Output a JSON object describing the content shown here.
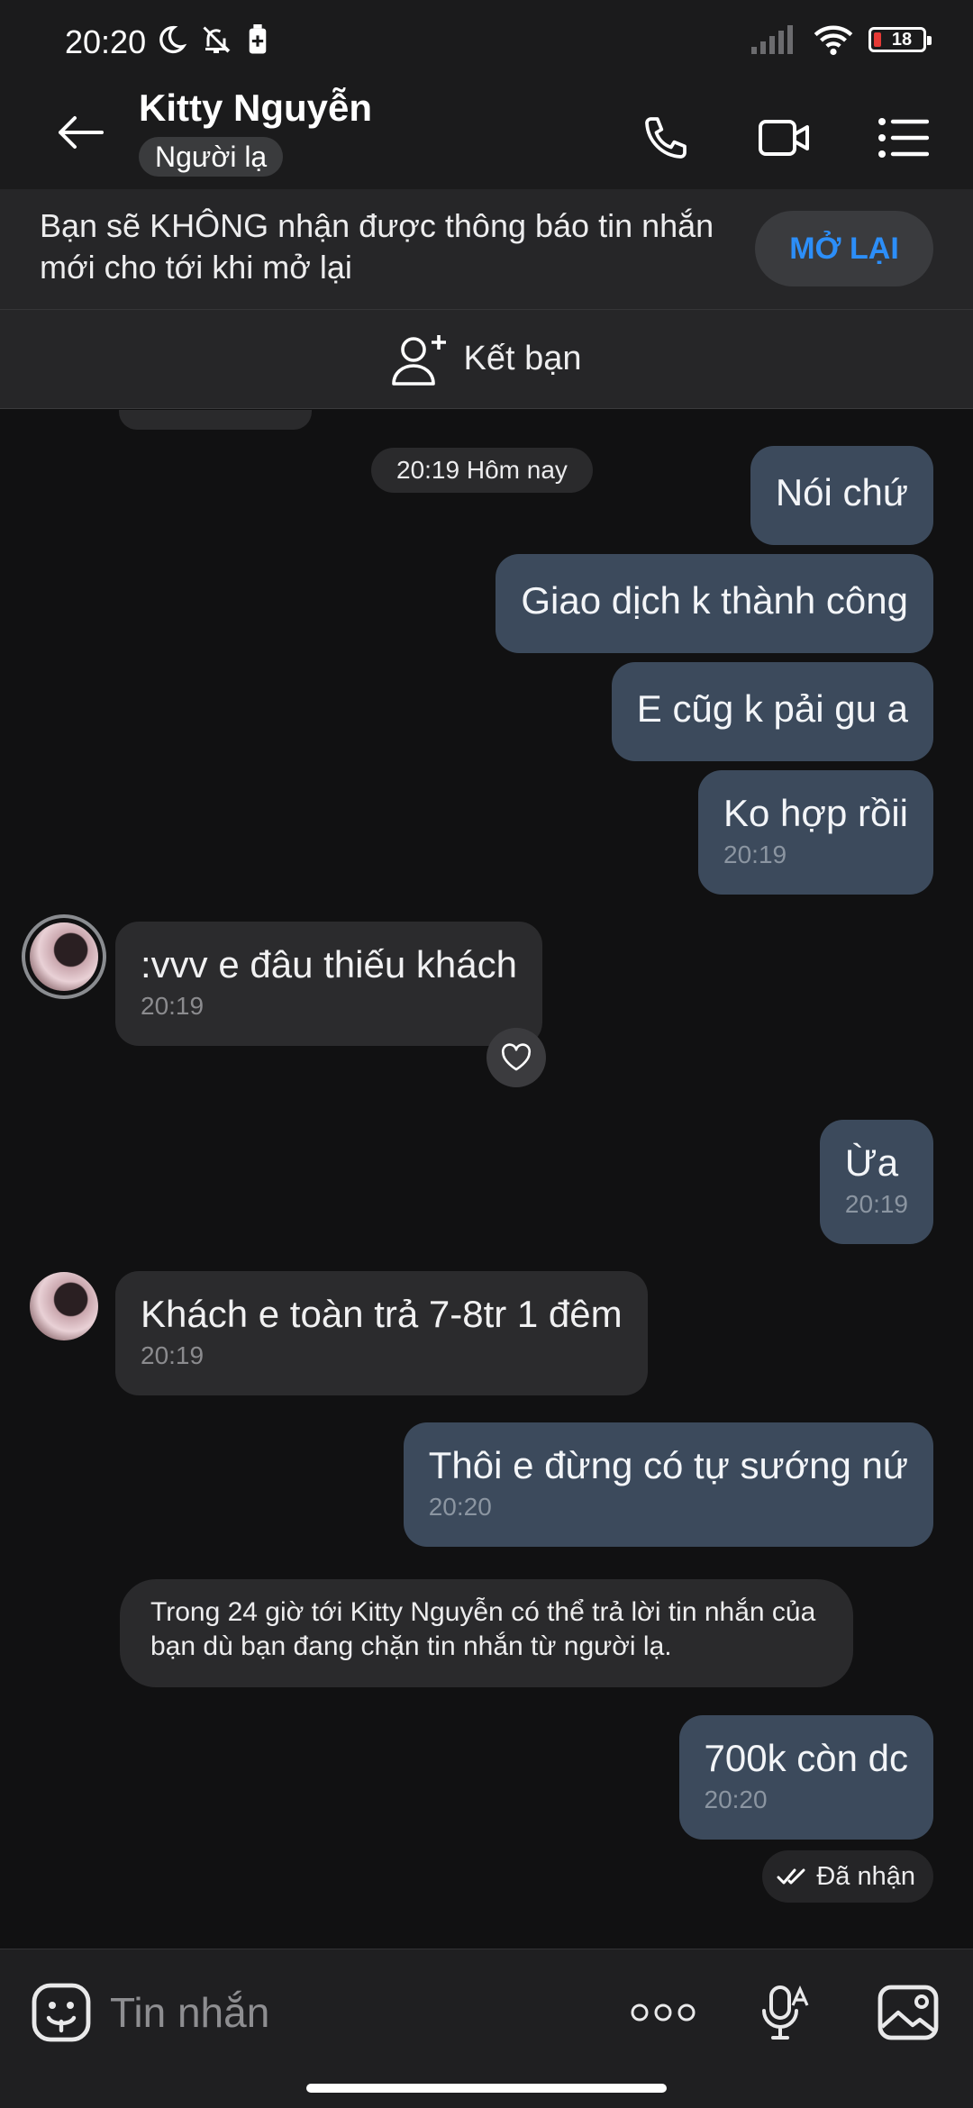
{
  "status_bar": {
    "time": "20:20",
    "battery": "18",
    "icons": [
      "moon-icon",
      "mute-icon",
      "battery-saver-icon",
      "signal-icon",
      "wifi-icon",
      "battery-icon"
    ]
  },
  "header": {
    "name": "Kitty Nguyễn",
    "badge": "Người lạ"
  },
  "notice": {
    "text": "Bạn sẽ KHÔNG nhận được thông báo tin nhắn mới cho tới khi mở lại",
    "button": "MỞ LẠI"
  },
  "add_friend": {
    "label": "Kết bạn"
  },
  "chat": {
    "date_chip": "20:19 Hôm nay",
    "messages": [
      {
        "dir": "out",
        "text": "Nói chứ",
        "time": ""
      },
      {
        "dir": "out",
        "text": "Giao dịch k thành công",
        "time": ""
      },
      {
        "dir": "out",
        "text": "E cũg k pải gu a",
        "time": ""
      },
      {
        "dir": "out",
        "text": "Ko hợp rồii",
        "time": "20:19"
      },
      {
        "dir": "in",
        "text": ":vvv e đâu thiếu khách",
        "time": "20:19"
      },
      {
        "dir": "out",
        "text": "Ừa",
        "time": "20:19"
      },
      {
        "dir": "in",
        "text": "Khách e toàn trả 7-8tr 1 đêm",
        "time": "20:19"
      },
      {
        "dir": "out",
        "text": "Thôi e đừng có tự sướng nứ",
        "time": "20:20"
      },
      {
        "dir": "out",
        "text": "700k còn dc",
        "time": "20:20"
      }
    ],
    "system_message": "Trong 24 giờ tới Kitty Nguyễn có thể trả lời tin nhắn của bạn dù bạn đang chặn tin nhắn từ người lạ.",
    "read_status": "Đã nhận"
  },
  "input": {
    "placeholder": "Tin nhắn"
  },
  "colors": {
    "background": "#111112",
    "outgoing_bubble": "#3c4a5c",
    "incoming_bubble": "#2b2b2d",
    "accent": "#2c8ef8"
  }
}
